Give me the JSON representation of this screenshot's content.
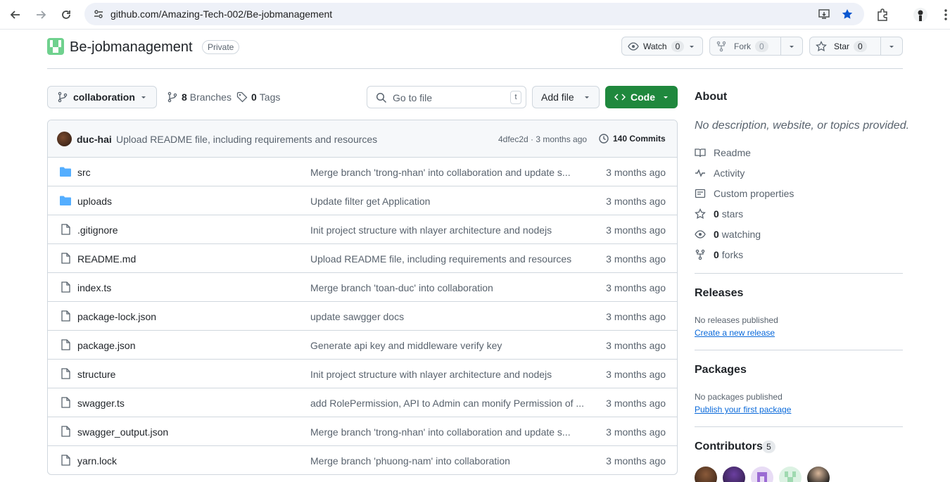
{
  "browser": {
    "url": "github.com/Amazing-Tech-002/Be-jobmanagement"
  },
  "repo": {
    "name": "Be-jobmanagement",
    "visibility": "Private",
    "watch_label": "Watch",
    "watch_count": "0",
    "fork_label": "Fork",
    "fork_count": "0",
    "star_label": "Star",
    "star_count": "0"
  },
  "toolbar": {
    "branch": "collaboration",
    "branches_count": "8",
    "branches_label": "Branches",
    "tags_count": "0",
    "tags_label": "Tags",
    "search_placeholder": "Go to file",
    "search_kbd": "t",
    "add_file_label": "Add file",
    "code_label": "Code"
  },
  "latest_commit": {
    "author": "duc-hai",
    "message": "Upload README file, including requirements and resources",
    "sha_time": "4dfec2d · 3 months ago",
    "commits_label": "140 Commits"
  },
  "files": [
    {
      "name": "src",
      "type": "folder",
      "message": "Merge branch 'trong-nhan' into collaboration and update s...",
      "time": "3 months ago"
    },
    {
      "name": "uploads",
      "type": "folder",
      "message": "Update filter get Application",
      "time": "3 months ago"
    },
    {
      "name": ".gitignore",
      "type": "file",
      "message": "Init project structure with nlayer architecture and nodejs",
      "time": "3 months ago"
    },
    {
      "name": "README.md",
      "type": "file",
      "message": "Upload README file, including requirements and resources",
      "time": "3 months ago"
    },
    {
      "name": "index.ts",
      "type": "file",
      "message": "Merge branch 'toan-duc' into collaboration",
      "time": "3 months ago"
    },
    {
      "name": "package-lock.json",
      "type": "file",
      "message": "update sawgger docs",
      "time": "3 months ago"
    },
    {
      "name": "package.json",
      "type": "file",
      "message": "Generate api key and middleware verify key",
      "time": "3 months ago"
    },
    {
      "name": "structure",
      "type": "file",
      "message": "Init project structure with nlayer architecture and nodejs",
      "time": "3 months ago"
    },
    {
      "name": "swagger.ts",
      "type": "file",
      "message": "add RolePermission, API to Admin can monify Permission of ...",
      "time": "3 months ago"
    },
    {
      "name": "swagger_output.json",
      "type": "file",
      "message": "Merge branch 'trong-nhan' into collaboration and update s...",
      "time": "3 months ago"
    },
    {
      "name": "yarn.lock",
      "type": "file",
      "message": "Merge branch 'phuong-nam' into collaboration",
      "time": "3 months ago"
    }
  ],
  "sidebar": {
    "about_title": "About",
    "description": "No description, website, or topics provided.",
    "readme": "Readme",
    "activity": "Activity",
    "custom_properties": "Custom properties",
    "stars_count": "0",
    "stars_label": "stars",
    "watching_count": "0",
    "watching_label": "watching",
    "forks_count": "0",
    "forks_label": "forks",
    "releases_title": "Releases",
    "releases_empty": "No releases published",
    "releases_link": "Create a new release",
    "packages_title": "Packages",
    "packages_empty": "No packages published",
    "packages_link": "Publish your first package",
    "contributors_title": "Contributors",
    "contributors_count": "5"
  },
  "colors": {
    "accent_green": "#1f883d",
    "link_blue": "#0969da",
    "folder_blue": "#54aeff"
  }
}
